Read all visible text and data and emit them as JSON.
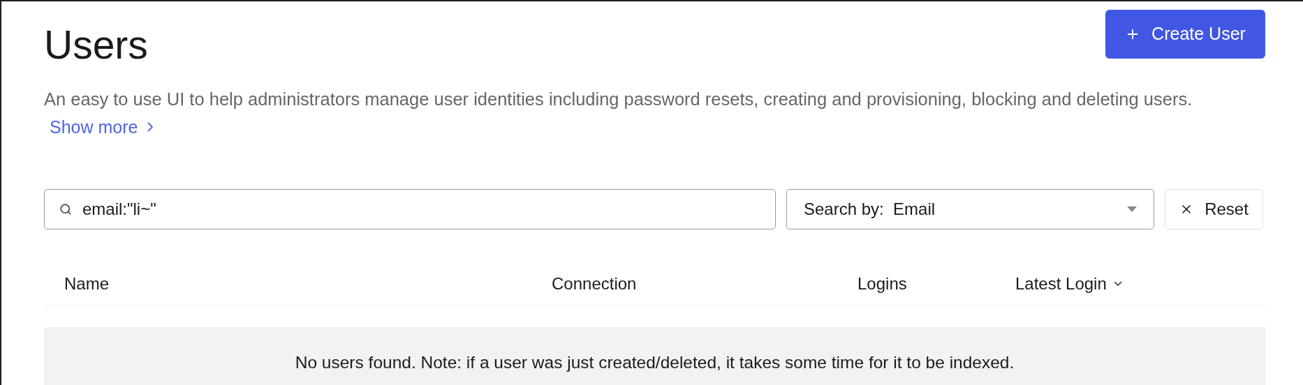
{
  "header": {
    "title": "Users",
    "create_button": "Create User"
  },
  "description": "An easy to use UI to help administrators manage user identities including password resets, creating and provisioning, blocking and deleting users.",
  "show_more": "Show more",
  "search": {
    "value": "email:\"li~\""
  },
  "search_by": {
    "label": "Search by:",
    "value": "Email"
  },
  "reset_button": "Reset",
  "table": {
    "columns": [
      {
        "label": "Name",
        "sortable": false
      },
      {
        "label": "Connection",
        "sortable": false
      },
      {
        "label": "Logins",
        "sortable": false
      },
      {
        "label": "Latest Login",
        "sortable": true
      }
    ],
    "empty_message": "No users found. Note: if a user was just created/deleted, it takes some time for it to be indexed."
  }
}
